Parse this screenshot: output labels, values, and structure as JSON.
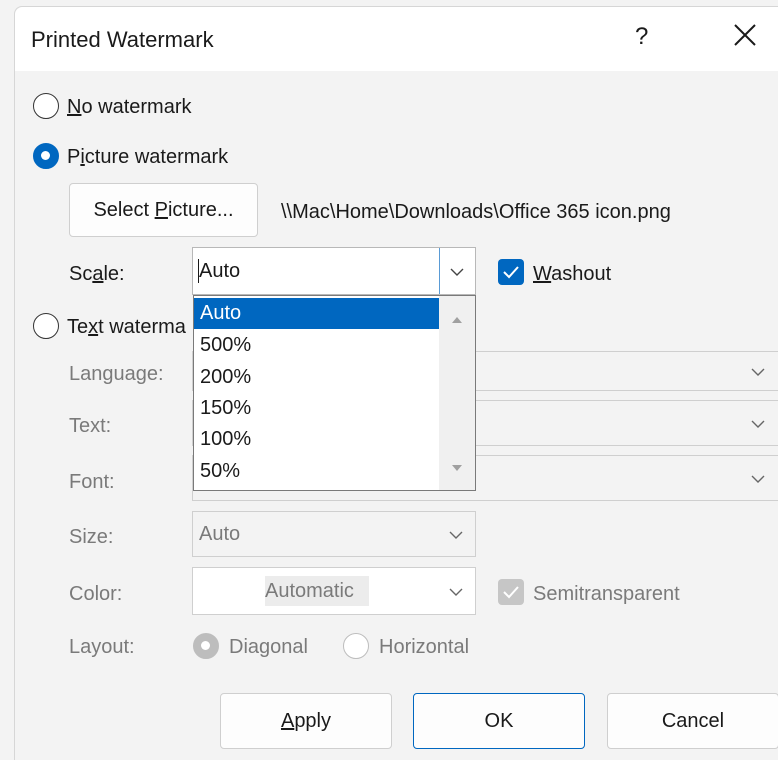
{
  "dialog": {
    "title": "Printed Watermark",
    "help_label": "?",
    "close_icon": "close-icon"
  },
  "options": {
    "no_watermark": {
      "pre": "",
      "key": "N",
      "post": "o watermark",
      "checked": false
    },
    "picture_watermark": {
      "pre": "P",
      "key": "i",
      "post": "cture watermark",
      "checked": true
    },
    "text_watermark": {
      "pre": "Te",
      "key": "x",
      "post": "t waterma",
      "checked": false
    }
  },
  "picture": {
    "select_button": {
      "pre": "Select ",
      "key": "P",
      "post": "icture..."
    },
    "path": "\\\\Mac\\Home\\Downloads\\Office 365 icon.png",
    "scale_label": {
      "pre": "Sc",
      "key": "a",
      "post": "le:"
    },
    "scale_value": "Auto",
    "washout_label": {
      "pre": "",
      "key": "W",
      "post": "ashout"
    },
    "washout_checked": true
  },
  "scale_dropdown": {
    "options": [
      "Auto",
      "500%",
      "200%",
      "150%",
      "100%",
      "50%"
    ],
    "selected_index": 0
  },
  "text_section": {
    "language_label": "Language:",
    "text_label": "Text:",
    "font_label": "Font:",
    "size_label": "Size:",
    "size_value": "Auto",
    "color_label": "Color:",
    "color_value": "Automatic",
    "semitransparent_label": "Semitransparent",
    "semitransparent_checked": true,
    "layout_label": "Layout:",
    "layout_diagonal": "Diagonal",
    "layout_horizontal": "Horizontal",
    "layout_selected": "Diagonal"
  },
  "footer": {
    "apply": {
      "pre": "",
      "key": "A",
      "post": "pply"
    },
    "ok": "OK",
    "cancel": "Cancel"
  },
  "colors": {
    "accent": "#0067c0",
    "disabled": "#c6c6c6"
  }
}
